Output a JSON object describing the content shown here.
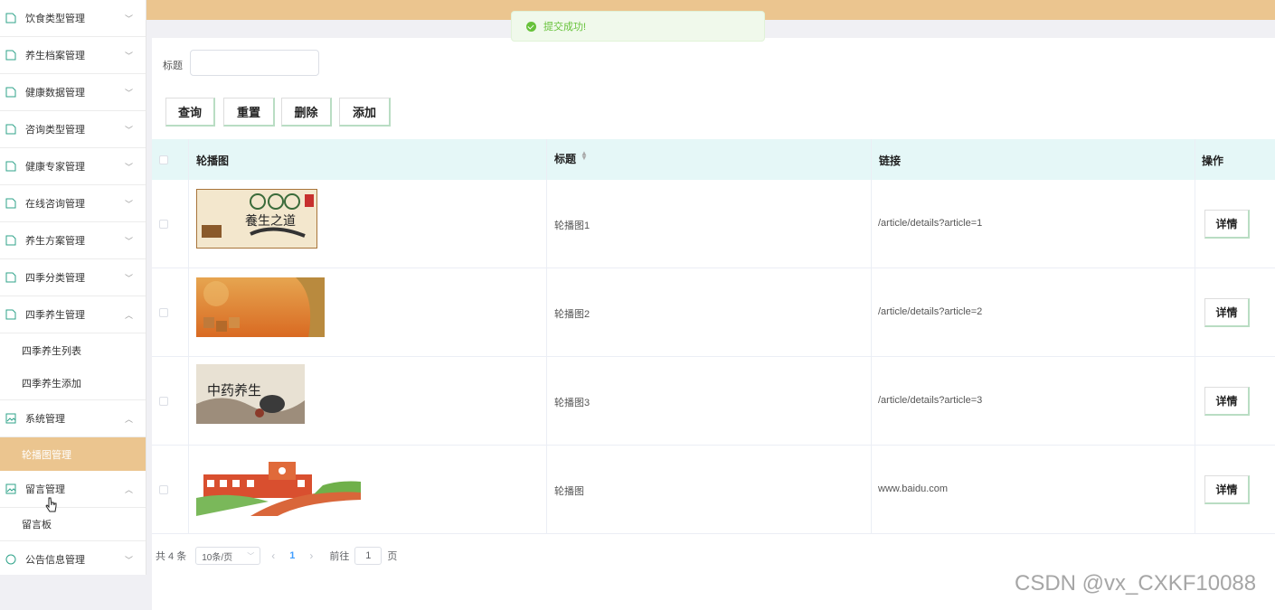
{
  "sidebar": {
    "items": [
      {
        "label": "饮食类型管理",
        "icon": "file-icon",
        "expanded": false
      },
      {
        "label": "养生档案管理",
        "icon": "file-icon",
        "expanded": false
      },
      {
        "label": "健康数据管理",
        "icon": "file-icon",
        "expanded": false
      },
      {
        "label": "咨询类型管理",
        "icon": "file-icon",
        "expanded": false
      },
      {
        "label": "健康专家管理",
        "icon": "file-icon",
        "expanded": false
      },
      {
        "label": "在线咨询管理",
        "icon": "file-icon",
        "expanded": false
      },
      {
        "label": "养生方案管理",
        "icon": "file-icon",
        "expanded": false
      },
      {
        "label": "四季分类管理",
        "icon": "file-icon",
        "expanded": false
      },
      {
        "label": "四季养生管理",
        "icon": "file-icon",
        "expanded": true
      },
      {
        "label": "系统管理",
        "icon": "picture-icon",
        "expanded": true
      },
      {
        "label": "留言管理",
        "icon": "picture-icon",
        "expanded": true
      },
      {
        "label": "公告信息管理",
        "icon": "info-icon",
        "expanded": false
      }
    ],
    "sub_season": [
      "四季养生列表",
      "四季养生添加"
    ],
    "sub_system": [
      "轮播图管理"
    ],
    "sub_message": [
      "留言板"
    ],
    "active_color": "#ebc58f"
  },
  "toast": {
    "message": "提交成功!",
    "color": "#67c23a"
  },
  "search": {
    "label": "标题",
    "value": ""
  },
  "buttons": {
    "query": "查询",
    "reset": "重置",
    "delete": "删除",
    "add": "添加"
  },
  "table": {
    "headers": {
      "image": "轮播图",
      "title": "标题",
      "link": "链接",
      "action": "操作"
    },
    "rows": [
      {
        "title": "轮播图1",
        "link": "/article/details?article=1",
        "action": "详情",
        "image_text": "養生之道"
      },
      {
        "title": "轮播图2",
        "link": "/article/details?article=2",
        "action": "详情",
        "image_text": ""
      },
      {
        "title": "轮播图3",
        "link": "/article/details?article=3",
        "action": "详情",
        "image_text": "中药养生"
      },
      {
        "title": "轮播图",
        "link": "www.baidu.com",
        "action": "详情",
        "image_text": ""
      }
    ]
  },
  "pagination": {
    "total": "共 4 条",
    "page_size": "10条/页",
    "current": "1",
    "goto_label": "前往",
    "goto_value": "1",
    "page_suffix": "页"
  },
  "watermark": "CSDN @vx_CXKF10088",
  "colors": {
    "accent": "#ebc58f",
    "header_bg": "#e5f7f7",
    "button_border": "#b9ddc3"
  }
}
